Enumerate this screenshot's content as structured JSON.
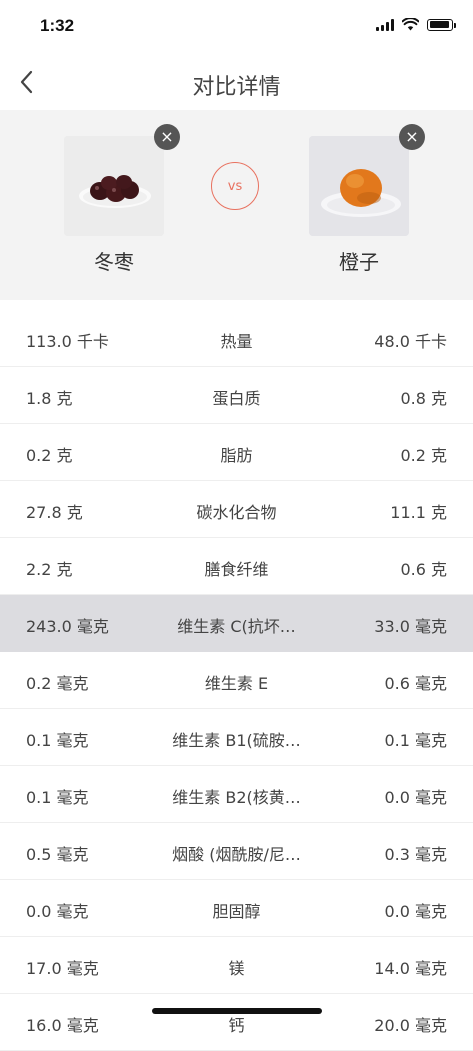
{
  "status_bar": {
    "time": "1:32"
  },
  "nav": {
    "title": "对比详情"
  },
  "compare": {
    "left": {
      "name": "冬枣",
      "image": "jujube-on-plate"
    },
    "vs": "vs",
    "right": {
      "name": "橙子",
      "image": "orange-on-plate"
    },
    "close_symbol": "×"
  },
  "nutrients": [
    {
      "left": "113.0 千卡",
      "name": "热量",
      "right": "48.0 千卡"
    },
    {
      "left": "1.8 克",
      "name": "蛋白质",
      "right": "0.8 克"
    },
    {
      "left": "0.2 克",
      "name": "脂肪",
      "right": "0.2 克"
    },
    {
      "left": "27.8 克",
      "name": "碳水化合物",
      "right": "11.1 克"
    },
    {
      "left": "2.2 克",
      "name": "膳食纤维",
      "right": "0.6 克"
    },
    {
      "left": "243.0 毫克",
      "name": "维生素 C(抗坏…",
      "right": "33.0 毫克"
    },
    {
      "left": "0.2 毫克",
      "name": "维生素 E",
      "right": "0.6 毫克"
    },
    {
      "left": "0.1 毫克",
      "name": "维生素 B1(硫胺…",
      "right": "0.1 毫克"
    },
    {
      "left": "0.1 毫克",
      "name": "维生素 B2(核黄…",
      "right": "0.0 毫克"
    },
    {
      "left": "0.5 毫克",
      "name": "烟酸 (烟酰胺/尼…",
      "right": "0.3 毫克"
    },
    {
      "left": "0.0 毫克",
      "name": "胆固醇",
      "right": "0.0 毫克"
    },
    {
      "left": "17.0 毫克",
      "name": "镁",
      "right": "14.0 毫克"
    },
    {
      "left": "16.0 毫克",
      "name": "钙",
      "right": "20.0 毫克"
    }
  ],
  "highlight_color": "#dcdce0",
  "accent_color": "#e8715f"
}
